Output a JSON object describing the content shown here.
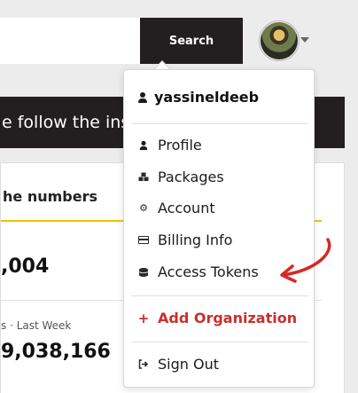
{
  "search": {
    "button_label": "Search"
  },
  "banner": {
    "text": "e follow the ins"
  },
  "stats": {
    "title": "he numbers",
    "value_one": ",004",
    "period_label": "s · Last Week",
    "value_two": "9,038,166"
  },
  "menu": {
    "username": "yassineldeeb",
    "items": [
      {
        "label": "Profile",
        "icon": "user-icon"
      },
      {
        "label": "Packages",
        "icon": "cubes-icon"
      },
      {
        "label": "Account",
        "icon": "gear-icon"
      },
      {
        "label": "Billing Info",
        "icon": "credit-card-icon"
      },
      {
        "label": "Access Tokens",
        "icon": "coins-icon"
      }
    ],
    "add_org_label": "Add Organization",
    "sign_out_label": "Sign Out"
  },
  "colors": {
    "accent": "#f2c200",
    "danger": "#c9302c",
    "dark": "#231f20",
    "annotation": "#d62828"
  }
}
